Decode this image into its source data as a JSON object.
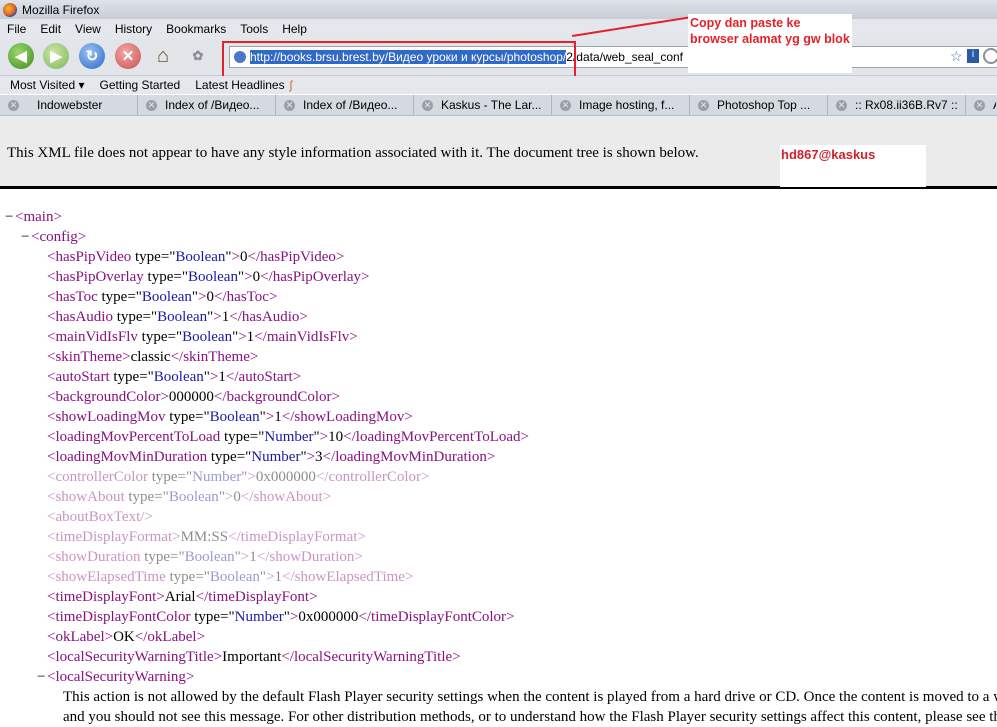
{
  "window": {
    "title": "Mozilla Firefox"
  },
  "menu": [
    "File",
    "Edit",
    "View",
    "History",
    "Bookmarks",
    "Tools",
    "Help"
  ],
  "urlbar": {
    "selected": "http://books.brsu.brest.by/Видео уроки и курсы/photoshop/",
    "rest": "2/data/web_seal_conf"
  },
  "annotation": {
    "note": "Copy dan paste ke browser alamat yg gw blok",
    "signature": "hd867@kaskus"
  },
  "bookmarks": [
    "Most Visited ▾",
    "Getting Started",
    "Latest Headlines"
  ],
  "tabs": [
    "Indowebster",
    "Index of /Видео...",
    "Index of /Видео...",
    "Kaskus - The Lar...",
    "Image hosting, f...",
    "Photoshop Top ...",
    ":: Rx08.ii36B.Rv7 ::",
    "A"
  ],
  "infobar": {
    "message": "This XML file does not appear to have any style information associated with it. The document tree is shown below."
  },
  "tree": {
    "root": "main",
    "config": "config",
    "items": [
      {
        "tag": "hasPipVideo",
        "attr": "type",
        "type": "Boolean",
        "value": "0",
        "faded": false
      },
      {
        "tag": "hasPipOverlay",
        "attr": "type",
        "type": "Boolean",
        "value": "0",
        "faded": false
      },
      {
        "tag": "hasToc",
        "attr": "type",
        "type": "Boolean",
        "value": "0",
        "faded": false
      },
      {
        "tag": "hasAudio",
        "attr": "type",
        "type": "Boolean",
        "value": "1",
        "faded": false
      },
      {
        "tag": "mainVidIsFlv",
        "attr": "type",
        "type": "Boolean",
        "value": "1",
        "faded": false
      },
      {
        "tag": "skinTheme",
        "attr": "",
        "type": "",
        "value": "classic",
        "faded": false
      },
      {
        "tag": "autoStart",
        "attr": "type",
        "type": "Boolean",
        "value": "1",
        "faded": false
      },
      {
        "tag": "backgroundColor",
        "attr": "",
        "type": "",
        "value": "000000",
        "faded": false
      },
      {
        "tag": "showLoadingMov",
        "attr": "type",
        "type": "Boolean",
        "value": "1",
        "faded": false
      },
      {
        "tag": "loadingMovPercentToLoad",
        "attr": "type",
        "type": "Number",
        "value": "10",
        "faded": false
      },
      {
        "tag": "loadingMovMinDuration",
        "attr": "type",
        "type": "Number",
        "value": "3",
        "faded": false
      },
      {
        "tag": "controllerColor",
        "attr": "type",
        "type": "Number",
        "value": "0x000000",
        "faded": true
      },
      {
        "tag": "showAbout",
        "attr": "type",
        "type": "Boolean",
        "value": "0",
        "faded": true
      },
      {
        "tag": "aboutBoxText",
        "attr": "",
        "type": "",
        "value": "",
        "faded": true,
        "selfclose": true
      },
      {
        "tag": "timeDisplayFormat",
        "attr": "",
        "type": "",
        "value": "MM:SS",
        "faded": true
      },
      {
        "tag": "showDuration",
        "attr": "type",
        "type": "Boolean",
        "value": "1",
        "faded": true
      },
      {
        "tag": "showElapsedTime",
        "attr": "type",
        "type": "Boolean",
        "value": "1",
        "faded": true
      },
      {
        "tag": "timeDisplayFont",
        "attr": "",
        "type": "",
        "value": "Arial",
        "faded": false
      },
      {
        "tag": "timeDisplayFontColor",
        "attr": "type",
        "type": "Number",
        "value": "0x000000",
        "faded": false
      },
      {
        "tag": "okLabel",
        "attr": "",
        "type": "",
        "value": "OK",
        "faded": false
      },
      {
        "tag": "localSecurityWarningTitle",
        "attr": "",
        "type": "",
        "value": "Important",
        "faded": false
      }
    ],
    "warning_tag": "localSecurityWarning",
    "warning_lines": [
      "This action is not allowed by the default Flash Player security settings when the content is played from a hard drive or CD. Once the content is moved to a w",
      "and you should not see this message. For other distribution methods, or to understand how the Flash Player security settings affect this content, please see the"
    ]
  }
}
